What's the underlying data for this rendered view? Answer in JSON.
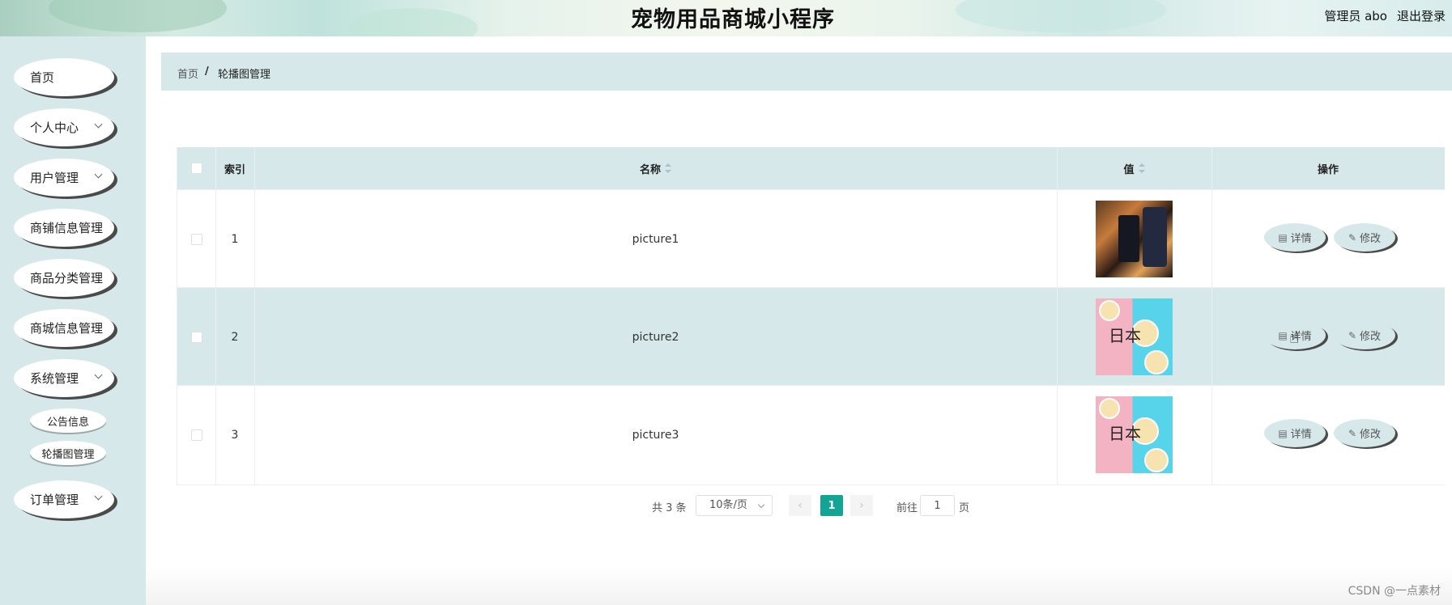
{
  "header": {
    "title": "宠物用品商城小程序",
    "user_info": "管理员 abo",
    "logout": "退出登录"
  },
  "sidebar": {
    "items": [
      {
        "label": "首页",
        "expandable": false
      },
      {
        "label": "个人中心",
        "expandable": true
      },
      {
        "label": "用户管理",
        "expandable": true
      },
      {
        "label": "商铺信息管理",
        "expandable": false
      },
      {
        "label": "商品分类管理",
        "expandable": false
      },
      {
        "label": "商城信息管理",
        "expandable": false
      },
      {
        "label": "系统管理",
        "expandable": true
      },
      {
        "label": "订单管理",
        "expandable": true
      }
    ],
    "sub_items": [
      {
        "label": "公告信息"
      },
      {
        "label": "轮播图管理"
      }
    ]
  },
  "breadcrumb": {
    "home": "首页",
    "separator": "/",
    "current": "轮播图管理"
  },
  "table": {
    "columns": {
      "index": "索引",
      "name": "名称",
      "value": "值",
      "actions": "操作"
    },
    "rows": [
      {
        "index": "1",
        "name": "picture1",
        "image": "bar-drinks-photo"
      },
      {
        "index": "2",
        "name": "picture2",
        "image": "japanese-food-photo"
      },
      {
        "index": "3",
        "name": "picture3",
        "image": "japanese-food-photo"
      }
    ],
    "actions": {
      "detail": "详情",
      "edit": "修改"
    }
  },
  "pagination": {
    "total": "共 3 条",
    "page_size": "10条/页",
    "current_page": "1",
    "goto_label": "前往",
    "goto_value": "1",
    "page_unit": "页"
  },
  "watermark": "CSDN @一点素材",
  "colors": {
    "accent": "#12a596",
    "panel": "#d6e8ea"
  }
}
